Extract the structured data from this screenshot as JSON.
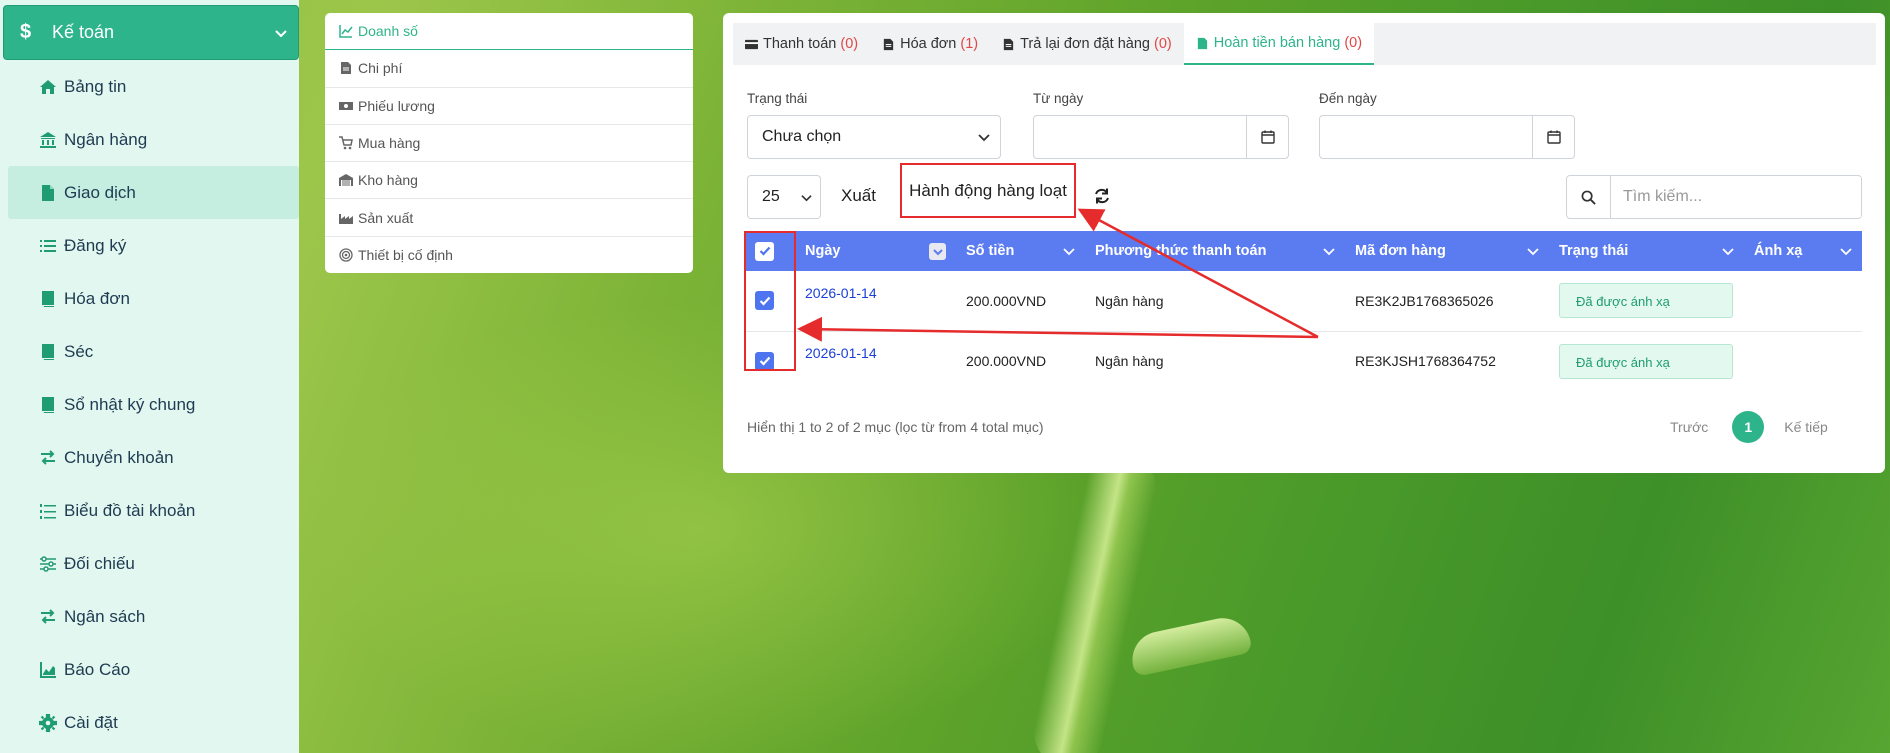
{
  "sidebar": {
    "header_title": "Kế toán",
    "items": [
      {
        "label": "Bảng tin",
        "icon": "home-icon"
      },
      {
        "label": "Ngân hàng",
        "icon": "bank-icon"
      },
      {
        "label": "Giao dịch",
        "icon": "file-icon",
        "active": true
      },
      {
        "label": "Đăng ký",
        "icon": "list-icon"
      },
      {
        "label": "Hóa đơn",
        "icon": "book-icon"
      },
      {
        "label": "Séc",
        "icon": "book-icon"
      },
      {
        "label": "Sổ nhật ký chung",
        "icon": "book-icon"
      },
      {
        "label": "Chuyển khoản",
        "icon": "exchange-icon"
      },
      {
        "label": "Biểu đồ tài khoản",
        "icon": "list-ol-icon"
      },
      {
        "label": "Đối chiếu",
        "icon": "sliders-icon"
      },
      {
        "label": "Ngân sách",
        "icon": "exchange-icon"
      },
      {
        "label": "Báo Cáo",
        "icon": "chart-icon"
      },
      {
        "label": "Cài đặt",
        "icon": "gear-icon"
      }
    ]
  },
  "menu": {
    "items": [
      {
        "label": "Doanh số",
        "active": true
      },
      {
        "label": "Chi phí"
      },
      {
        "label": "Phiếu lương"
      },
      {
        "label": "Mua hàng"
      },
      {
        "label": "Kho hàng"
      },
      {
        "label": "Sản xuất"
      },
      {
        "label": "Thiết bị cố định"
      }
    ]
  },
  "tabs": [
    {
      "label": "Thanh toán",
      "count": "(0)"
    },
    {
      "label": "Hóa đơn",
      "count": "(1)"
    },
    {
      "label": "Trả lại đơn đặt hàng",
      "count": "(0)"
    },
    {
      "label": "Hoàn tiền bán hàng",
      "count": "(0)",
      "active": true
    }
  ],
  "filters": {
    "status_label": "Trạng thái",
    "status_value": "Chưa chọn",
    "from_label": "Từ ngày",
    "to_label": "Đến ngày"
  },
  "toolbar": {
    "page_size": "25",
    "export_label": "Xuất",
    "bulk_label": "Hành động hàng loạt",
    "search_placeholder": "Tìm kiếm..."
  },
  "table": {
    "columns": [
      "Ngày",
      "Số tiền",
      "Phương thức thanh toán",
      "Mã đơn hàng",
      "Trạng thái",
      "Ánh xạ"
    ],
    "rows": [
      {
        "date": "2026-01-14",
        "amount": "200.000VND",
        "method": "Ngân hàng",
        "order": "RE3K2JB1768365026",
        "status": "Đã được ánh xạ",
        "mapping": ""
      },
      {
        "date": "2026-01-14",
        "amount": "200.000VND",
        "method": "Ngân hàng",
        "order": "RE3KJSH1768364752",
        "status": "Đã được ánh xạ",
        "mapping": ""
      }
    ]
  },
  "footer": {
    "info": "Hiển thị 1 to 2 of 2 mục (lọc từ from 4 total mục)",
    "prev": "Trước",
    "page": "1",
    "next": "Kế tiếp"
  },
  "colors": {
    "accent": "#2eb48a",
    "table_header": "#5b7cf0",
    "annotation": "#e52b2b",
    "sidebar_bg": "#e2f7ef"
  }
}
